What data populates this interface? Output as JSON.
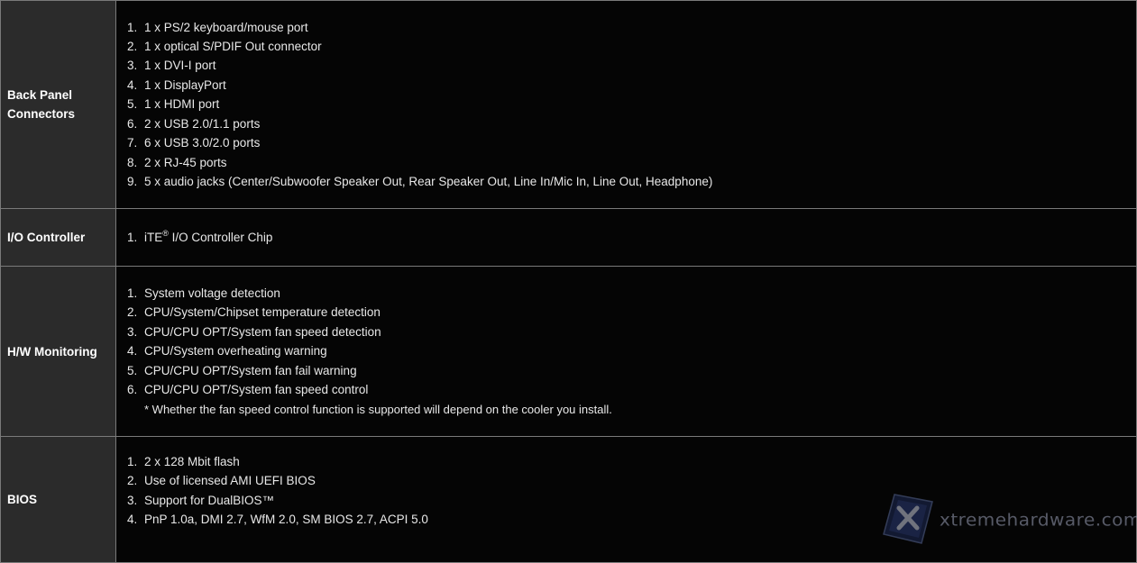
{
  "rows": [
    {
      "label_lines": [
        "Back Panel",
        "Connectors"
      ],
      "items": [
        "1 x PS/2 keyboard/mouse port",
        "1 x optical S/PDIF Out connector",
        "1 x DVI-I port",
        "1 x DisplayPort",
        "1 x HDMI port",
        "2 x USB 2.0/1.1 ports",
        "6 x USB 3.0/2.0 ports",
        "2 x RJ-45 ports",
        "5 x audio jacks (Center/Subwoofer Speaker Out, Rear Speaker Out, Line In/Mic In, Line Out, Headphone)"
      ]
    },
    {
      "label_lines": [
        "I/O Controller"
      ],
      "items_rich": {
        "brand": "iTE",
        "reg_mark": "®",
        "rest": " I/O Controller Chip"
      }
    },
    {
      "label_lines": [
        "H/W Monitoring"
      ],
      "items": [
        "System voltage detection",
        "CPU/System/Chipset temperature detection",
        "CPU/CPU OPT/System fan speed detection",
        "CPU/System overheating warning",
        "CPU/CPU OPT/System fan fail warning",
        "CPU/CPU OPT/System fan speed control"
      ],
      "note": "* Whether the fan speed control function is supported will depend on the cooler you install."
    },
    {
      "label_lines": [
        "BIOS"
      ],
      "items": [
        "2 x 128 Mbit flash",
        "Use of licensed AMI UEFI BIOS",
        "Support for DualBIOS™",
        "PnP 1.0a, DMI 2.7, WfM 2.0, SM BIOS 2.7, ACPI 5.0"
      ]
    }
  ],
  "numbers": [
    "1.",
    "2.",
    "3.",
    "4.",
    "5.",
    "6.",
    "7.",
    "8.",
    "9."
  ],
  "watermark": {
    "text": "xtremehardware.com",
    "icon": "x-logo-icon"
  },
  "colors": {
    "background": "#000000",
    "label_bg": "#2b2b2b",
    "border": "#7a7a7a",
    "text": "#e8e8e8"
  }
}
